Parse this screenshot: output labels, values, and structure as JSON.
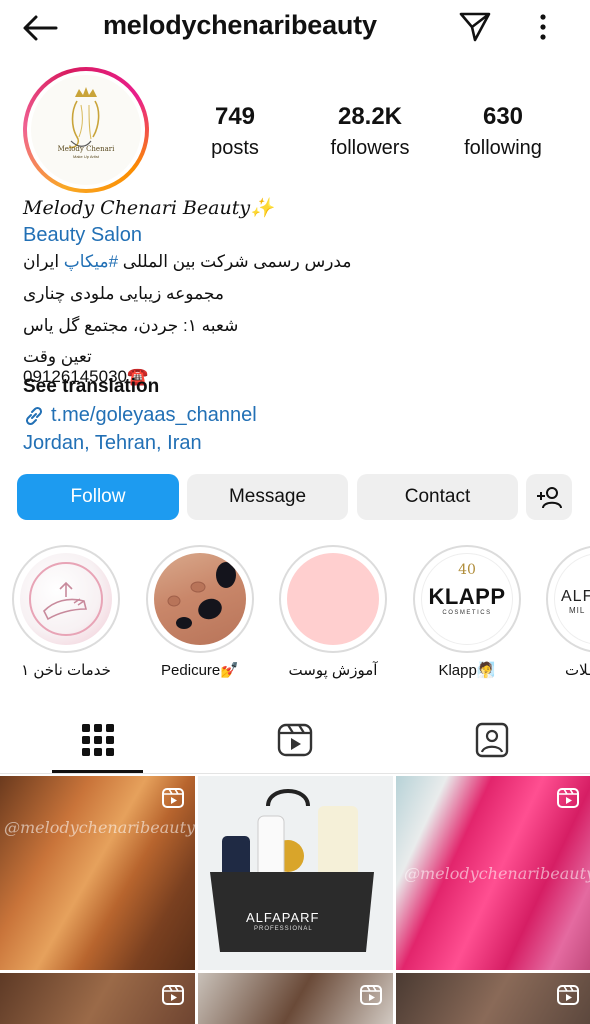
{
  "header": {
    "username": "melodychenaribeauty",
    "icons": [
      "back-arrow-icon",
      "send-icon",
      "more-vertical-icon"
    ]
  },
  "profile": {
    "logo_title": "Melody Chenari",
    "logo_subtitle": "Make Up Artist",
    "stats": [
      {
        "value": "749",
        "label": "posts"
      },
      {
        "value": "28.2K",
        "label": "followers"
      },
      {
        "value": "630",
        "label": "following"
      }
    ]
  },
  "bio": {
    "name": "Melody Chenari Beauty✨",
    "category": "Beauty Salon",
    "line1_prefix": "مدرس رسمی شرکت بین المللی ",
    "line1_hashtag": "#میکاپ",
    "line1_suffix": " ایران",
    "line2": "مجموعه زیبایی ملودی چناری",
    "line3": "شعبه ۱: جردن، مجتمع گل یاس",
    "line4": "تعین وقت ☎️09126145030",
    "see_translation": "See translation",
    "link": "t.me/goleyaas_channel",
    "location": "Jordan, Tehran, Iran"
  },
  "actions": {
    "follow": "Follow",
    "message": "Message",
    "contact": "Contact"
  },
  "highlights": [
    {
      "label": "خدمات ناخن ۱"
    },
    {
      "label": "Pedicure💅"
    },
    {
      "label": "آموزش پوست"
    },
    {
      "label": "Klapp🧖"
    },
    {
      "label": "ـلات"
    }
  ],
  "highlight_brand": {
    "klapp_logo": "KLAPP",
    "klapp_sub": "COSMETICS",
    "klapp_years": "40",
    "alfa_partial": "ALFA",
    "alfa_partial_sub": "MIL"
  },
  "tabs": [
    "grid-tab",
    "reels-tab",
    "tagged-tab"
  ],
  "posts": {
    "watermark": "@melodychenaribeauty",
    "bag_brand": "ALFAPARF",
    "bag_sub": "PROFESSIONAL"
  },
  "colors": {
    "accent_blue": "#1d9bf0",
    "link_blue": "#2270b5",
    "button_gray": "#efefef"
  }
}
